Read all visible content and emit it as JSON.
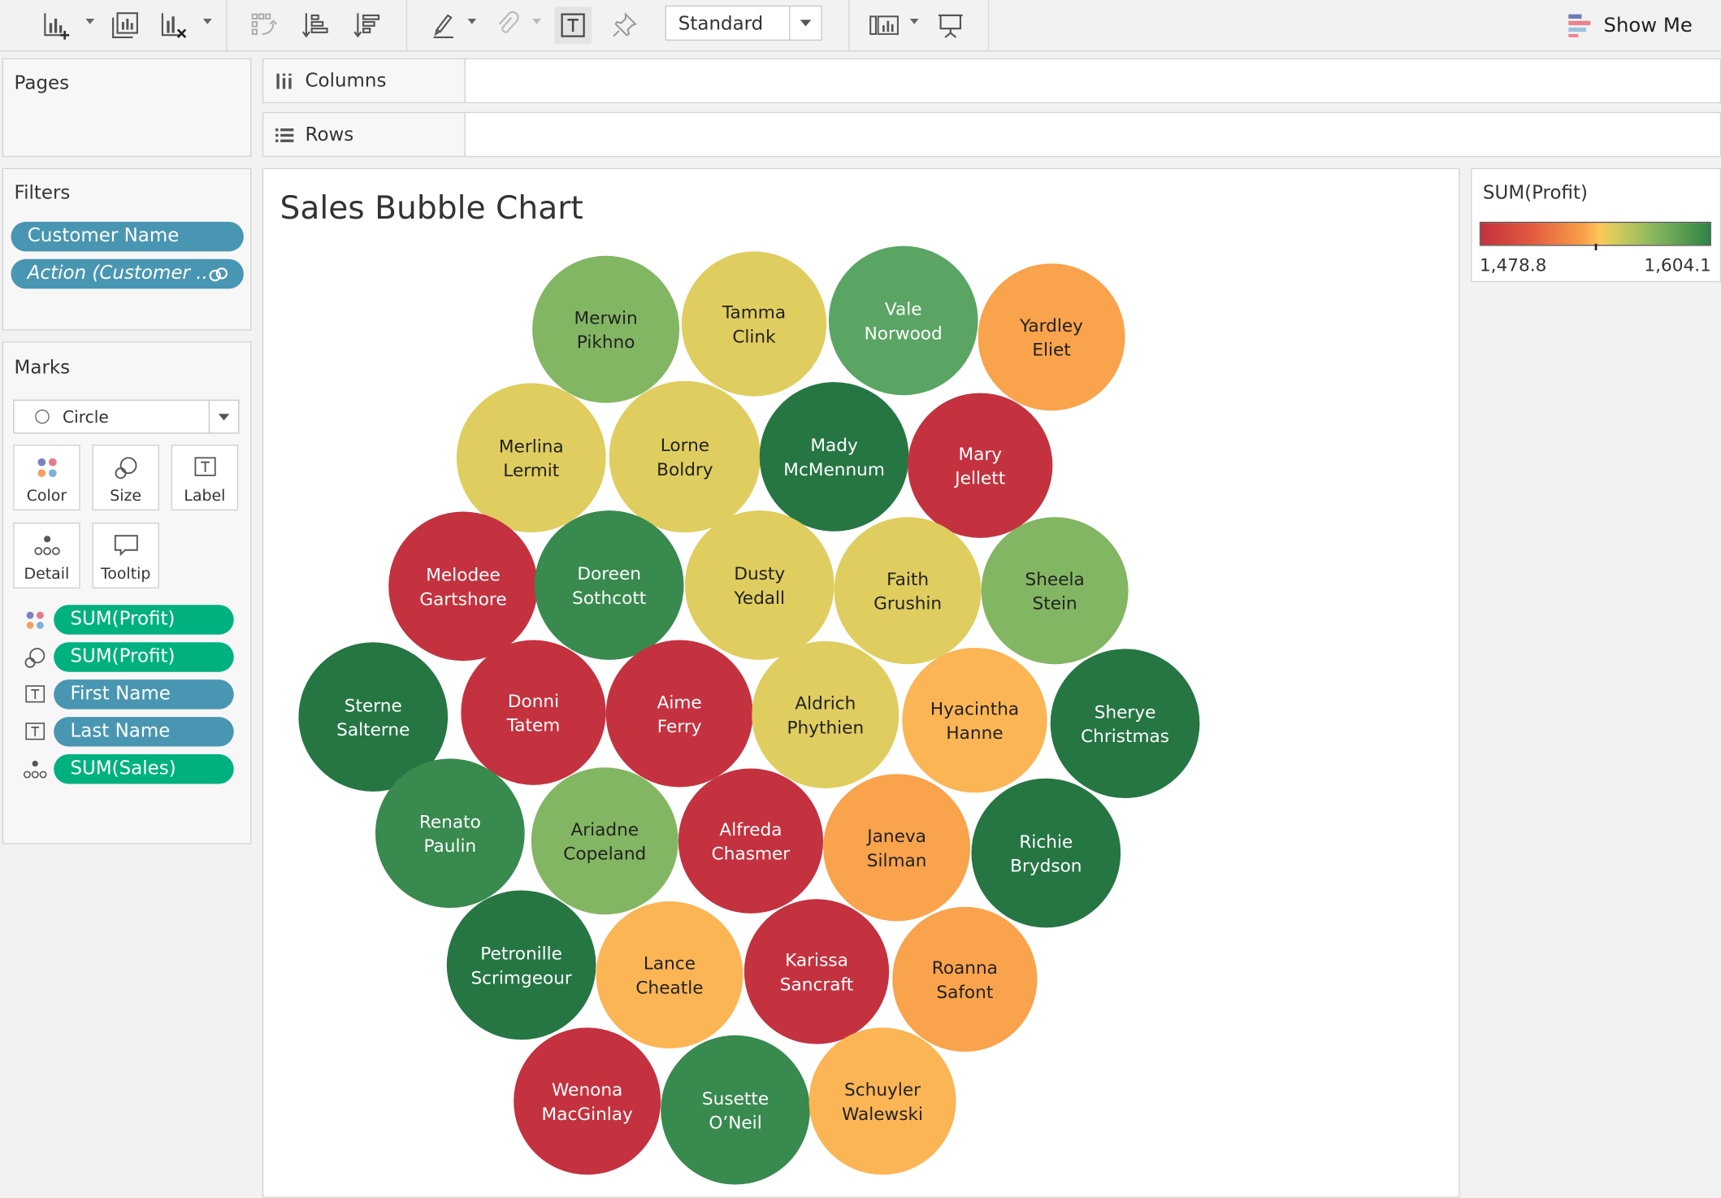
{
  "toolbar": {
    "fit_select": "Standard",
    "show_me_label": "Show Me"
  },
  "shelves": {
    "pages_title": "Pages",
    "columns_label": "Columns",
    "rows_label": "Rows"
  },
  "filters": {
    "title": "Filters",
    "items": [
      "Customer Name",
      "Action (Customer .."
    ]
  },
  "marks": {
    "title": "Marks",
    "mark_type": "Circle",
    "cards": [
      "Color",
      "Size",
      "Label",
      "Detail",
      "Tooltip"
    ],
    "fields": [
      {
        "encoding": "color",
        "label": "SUM(Profit)",
        "pill": "green"
      },
      {
        "encoding": "size",
        "label": "SUM(Profit)",
        "pill": "green"
      },
      {
        "encoding": "label",
        "label": "First Name",
        "pill": "blue"
      },
      {
        "encoding": "label",
        "label": "Last Name",
        "pill": "blue"
      },
      {
        "encoding": "detail",
        "label": "SUM(Sales)",
        "pill": "green"
      }
    ]
  },
  "legend": {
    "title": "SUM(Profit)",
    "min": "1,478.8",
    "max": "1,604.1"
  },
  "colors": {
    "red": "#c4323f",
    "orange": "#f9a34d",
    "light_orange": "#fbb555",
    "yellow": "#dfcd5f",
    "light_green": "#83b662",
    "mid_green": "#5aa564",
    "green": "#388a4e",
    "dark_green": "#257643"
  },
  "chart_data": {
    "type": "bubble",
    "title": "Sales Bubble Chart",
    "color_measure": "SUM(Profit)",
    "color_range": [
      1478.8,
      1604.1
    ],
    "bubbles": [
      {
        "first": "Merwin",
        "last": "Pikhno",
        "color": "light_green"
      },
      {
        "first": "Tamma",
        "last": "Clink",
        "color": "yellow"
      },
      {
        "first": "Vale",
        "last": "Norwood",
        "color": "mid_green"
      },
      {
        "first": "Yardley",
        "last": "Eliet",
        "color": "orange"
      },
      {
        "first": "Merlina",
        "last": "Lermit",
        "color": "yellow"
      },
      {
        "first": "Lorne",
        "last": "Boldry",
        "color": "yellow"
      },
      {
        "first": "Mady",
        "last": "McMennum",
        "color": "dark_green"
      },
      {
        "first": "Mary",
        "last": "Jellett",
        "color": "red"
      },
      {
        "first": "Melodee",
        "last": "Gartshore",
        "color": "red"
      },
      {
        "first": "Doreen",
        "last": "Sothcott",
        "color": "green"
      },
      {
        "first": "Dusty",
        "last": "Yedall",
        "color": "yellow"
      },
      {
        "first": "Faith",
        "last": "Grushin",
        "color": "yellow"
      },
      {
        "first": "Sheela",
        "last": "Stein",
        "color": "light_green"
      },
      {
        "first": "Sterne",
        "last": "Salterne",
        "color": "dark_green"
      },
      {
        "first": "Donni",
        "last": "Tatem",
        "color": "red"
      },
      {
        "first": "Aime",
        "last": "Ferry",
        "color": "red"
      },
      {
        "first": "Aldrich",
        "last": "Phythien",
        "color": "yellow"
      },
      {
        "first": "Hyacintha",
        "last": "Hanne",
        "color": "light_orange"
      },
      {
        "first": "Sherye",
        "last": "Christmas",
        "color": "dark_green"
      },
      {
        "first": "Renato",
        "last": "Paulin",
        "color": "green"
      },
      {
        "first": "Ariadne",
        "last": "Copeland",
        "color": "light_green"
      },
      {
        "first": "Alfreda",
        "last": "Chasmer",
        "color": "red"
      },
      {
        "first": "Janeva",
        "last": "Silman",
        "color": "orange"
      },
      {
        "first": "Richie",
        "last": "Brydson",
        "color": "dark_green"
      },
      {
        "first": "Petronille",
        "last": "Scrimgeour",
        "color": "dark_green"
      },
      {
        "first": "Lance",
        "last": "Cheatle",
        "color": "light_orange"
      },
      {
        "first": "Karissa",
        "last": "Sancraft",
        "color": "red"
      },
      {
        "first": "Roanna",
        "last": "Safont",
        "color": "orange"
      },
      {
        "first": "Wenona",
        "last": "MacGinlay",
        "color": "red"
      },
      {
        "first": "Susette",
        "last": "O’Neil",
        "color": "green"
      },
      {
        "first": "Schuyler",
        "last": "Walewski",
        "color": "light_orange"
      }
    ]
  }
}
